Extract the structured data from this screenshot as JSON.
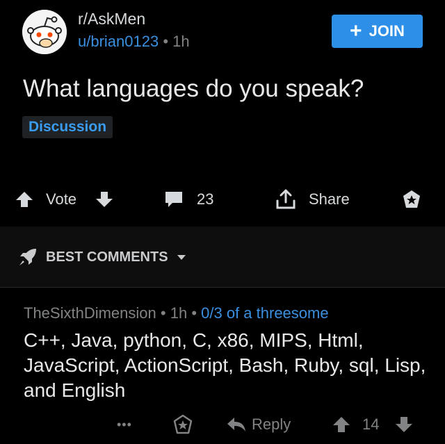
{
  "post": {
    "subreddit": "r/AskMen",
    "author": "u/brian0123",
    "separator": "•",
    "age": "1h",
    "join_label": "JOIN",
    "title": "What languages do you speak?",
    "flair": "Discussion",
    "vote_label": "Vote",
    "comment_count": "23",
    "share_label": "Share"
  },
  "sort": {
    "label": "BEST COMMENTS"
  },
  "comment": {
    "author": "TheSixthDimension",
    "separator": "•",
    "age": "1h",
    "flair": "0/3 of a threesome",
    "body": "C++, Java, python, C, x86, MIPS, Html, JavaScript, ActionScript, Bash, Ruby, sql, Lisp, and English",
    "more": "•••",
    "reply_label": "Reply",
    "score": "14"
  },
  "colors": {
    "accent": "#2d8fe8",
    "link": "#3a8fe0",
    "muted": "#818384",
    "text": "#d7dadc"
  }
}
